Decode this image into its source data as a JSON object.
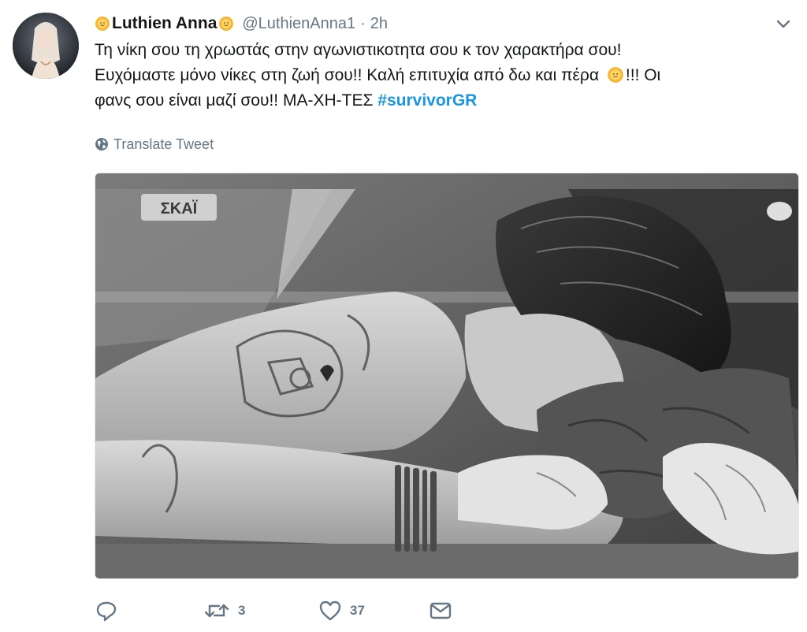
{
  "tweet": {
    "author_name": "Luthien Anna",
    "handle": "@LuthienAnna1",
    "separator": "·",
    "time": "2h",
    "text_line1": "Τη νίκη σου τη χρωστάς στην αγωνιστικοτητα σου κ τον χαρακτήρα σου!",
    "text_line2a": "Ευχόμαστε μόνο νίκες στη ζωή σου!! Καλή επιτυχία από δω και πέρα",
    "text_line2b": "!!! Οι",
    "text_line3": "φανς σου είναι μαζί σου!! ΜΑ-ΧΗ-ΤΕΣ ",
    "hashtag": "#survivorGR",
    "translate_label": "Translate Tweet",
    "media_logo_text": "ΣΚΑΪ"
  },
  "actions": {
    "reply_count": "",
    "retweet_count": "3",
    "like_count": "37"
  },
  "icons": {
    "sun": "sun-emoji",
    "globe": "globe-icon",
    "caret": "chevron-down-icon",
    "reply": "reply-icon",
    "retweet": "retweet-icon",
    "like": "heart-icon",
    "dm": "envelope-icon"
  },
  "colors": {
    "link": "#1b95e0",
    "muted": "#657786",
    "text": "#14171a"
  }
}
